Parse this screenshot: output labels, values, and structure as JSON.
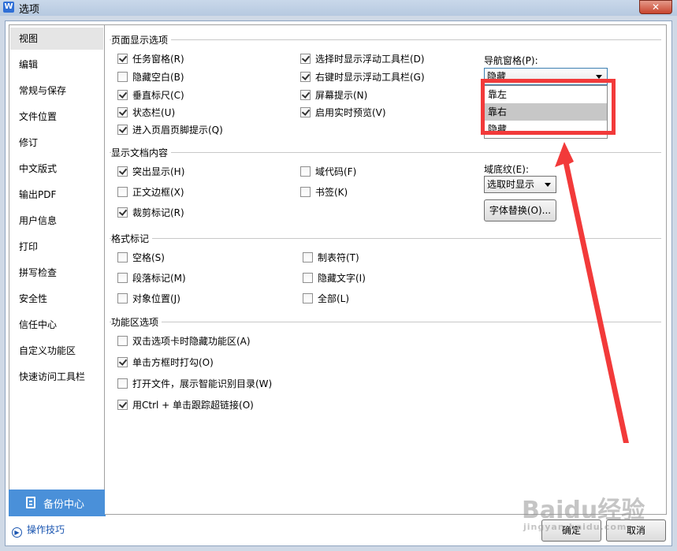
{
  "window": {
    "title": "选项",
    "close": "✕",
    "app_icon": "W"
  },
  "sidebar": {
    "items": [
      {
        "label": "视图",
        "active": true
      },
      {
        "label": "编辑"
      },
      {
        "label": "常规与保存"
      },
      {
        "label": "文件位置"
      },
      {
        "label": "修订"
      },
      {
        "label": "中文版式"
      },
      {
        "label": "输出PDF"
      },
      {
        "label": "用户信息"
      },
      {
        "label": "打印"
      },
      {
        "label": "拼写检查"
      },
      {
        "label": "安全性"
      },
      {
        "label": "信任中心"
      },
      {
        "label": "自定义功能区"
      },
      {
        "label": "快速访问工具栏"
      }
    ],
    "backup": "备份中心",
    "tips": "操作技巧"
  },
  "page_display": {
    "title": "页面显示选项",
    "col1": [
      {
        "label": "任务窗格(R)",
        "checked": true
      },
      {
        "label": "隐藏空白(B)",
        "checked": false
      },
      {
        "label": "垂直标尺(C)",
        "checked": true
      },
      {
        "label": "状态栏(U)",
        "checked": true
      },
      {
        "label": "进入页眉页脚提示(Q)",
        "checked": true
      }
    ],
    "col2": [
      {
        "label": "选择时显示浮动工具栏(D)",
        "checked": true
      },
      {
        "label": "右键时显示浮动工具栏(G)",
        "checked": true
      },
      {
        "label": "屏幕提示(N)",
        "checked": true
      },
      {
        "label": "启用实时预览(V)",
        "checked": true
      }
    ],
    "nav_label": "导航窗格(P):",
    "nav_value": "隐藏",
    "nav_options": [
      "靠左",
      "靠右",
      "隐藏"
    ],
    "nav_hover_index": 1
  },
  "doc_content": {
    "title": "显示文档内容",
    "col1": [
      {
        "label": "突出显示(H)",
        "checked": true
      },
      {
        "label": "正文边框(X)",
        "checked": false
      },
      {
        "label": "裁剪标记(R)",
        "checked": true
      }
    ],
    "col2": [
      {
        "label": "域代码(F)",
        "checked": false
      },
      {
        "label": "书签(K)",
        "checked": false
      }
    ],
    "field_label": "域底纹(E):",
    "field_value": "选取时显示",
    "font_replace": "字体替换(O)..."
  },
  "format_marks": {
    "title": "格式标记",
    "col1": [
      {
        "label": "空格(S)",
        "checked": false
      },
      {
        "label": "段落标记(M)",
        "checked": false
      },
      {
        "label": "对象位置(J)",
        "checked": false
      }
    ],
    "col2": [
      {
        "label": "制表符(T)",
        "checked": false
      },
      {
        "label": "隐藏文字(I)",
        "checked": false
      },
      {
        "label": "全部(L)",
        "checked": false
      }
    ]
  },
  "ribbon": {
    "title": "功能区选项",
    "items": [
      {
        "label": "双击选项卡时隐藏功能区(A)",
        "checked": false
      },
      {
        "label": "单击方框时打勾(O)",
        "checked": true
      },
      {
        "label": "打开文件，展示智能识别目录(W)",
        "checked": false
      },
      {
        "label": "用Ctrl + 单击跟踪超链接(O)",
        "checked": true
      }
    ]
  },
  "footer": {
    "ok": "确定",
    "cancel": "取消"
  },
  "watermark": {
    "main": "Baidu经验",
    "sub": "jingyan.baidu.com"
  },
  "colors": {
    "accent": "#4a90d9",
    "highlight": "#f23a3a"
  }
}
